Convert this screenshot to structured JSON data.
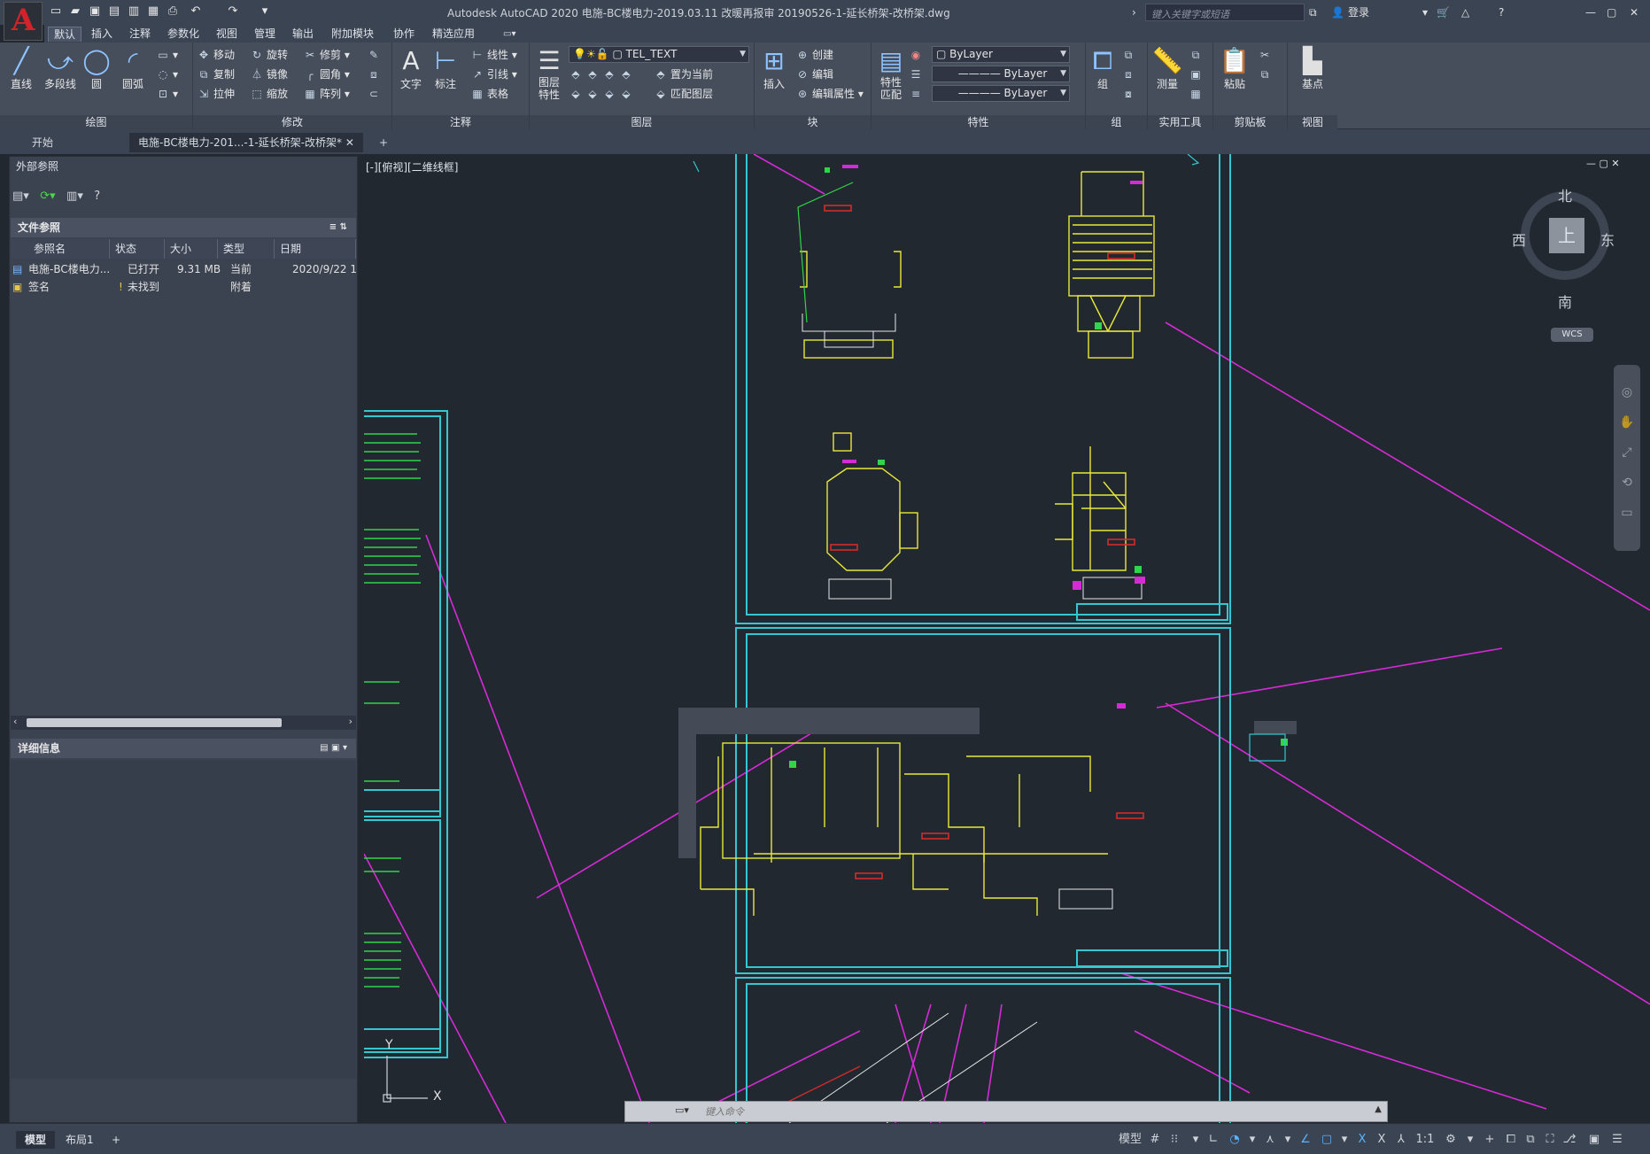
{
  "titlebar": {
    "title": "Autodesk AutoCAD 2020    电施-BC楼电力-2019.03.11 改暖再报审 20190526-1-延长桥架-改桥架.dwg",
    "search_placeholder": "键入关键字或短语",
    "login": "登录"
  },
  "menu": [
    "默认",
    "插入",
    "注释",
    "参数化",
    "视图",
    "管理",
    "输出",
    "附加模块",
    "协作",
    "精选应用"
  ],
  "ribbon": {
    "draw": {
      "title": "绘图",
      "line": "直线",
      "polyline": "多段线",
      "circle": "圆",
      "arc": "圆弧"
    },
    "modify": {
      "title": "修改",
      "move": "移动",
      "rotate": "旋转",
      "trim": "修剪",
      "copy": "复制",
      "mirror": "镜像",
      "fillet": "圆角",
      "stretch": "拉伸",
      "scale": "缩放",
      "array": "阵列"
    },
    "annotation": {
      "title": "注释",
      "text": "文字",
      "dim": "标注",
      "linear": "线性",
      "leader": "引线",
      "table": "表格"
    },
    "layers": {
      "title": "图层",
      "props": "图层\n特性",
      "layer_name": "TEL_TEXT",
      "set_current": "置为当前",
      "match": "匹配图层"
    },
    "block": {
      "title": "块",
      "insert": "插入",
      "create": "创建",
      "edit": "编辑",
      "edit_attr": "编辑属性"
    },
    "properties": {
      "title": "特性",
      "match": "特性\n匹配",
      "color": "ByLayer",
      "linetype": "ByLayer",
      "lineweight": "ByLayer"
    },
    "groups": {
      "title": "组",
      "group": "组"
    },
    "utilities": {
      "title": "实用工具",
      "measure": "测量"
    },
    "clipboard": {
      "title": "剪贴板",
      "paste": "粘贴"
    },
    "view": {
      "title": "视图",
      "base": "基点"
    }
  },
  "filetabs": {
    "start": "开始",
    "doc": "电施-BC楼电力-201...-1-延长桥架-改桥架*",
    "plus": "+"
  },
  "xref": {
    "title": "外部参照",
    "section": "文件参照",
    "columns": [
      "参照名",
      "状态",
      "大小",
      "类型",
      "日期"
    ],
    "rows": [
      {
        "name": "电施-BC楼电力...",
        "status": "已打开",
        "size": "9.31 MB",
        "type": "当前",
        "date": "2020/9/22 1"
      },
      {
        "name": "签名",
        "status": "未找到",
        "size": "",
        "type": "附着",
        "date": ""
      }
    ],
    "details": "详细信息"
  },
  "viewport": {
    "label": "[-][俯视][二维线框]",
    "north": "北",
    "south": "南",
    "east": "东",
    "west": "西",
    "top": "上",
    "wcs": "WCS",
    "ucs_x": "X",
    "ucs_y": "Y"
  },
  "command": {
    "placeholder": "键入命令"
  },
  "status": {
    "model": "模型",
    "layout1": "布局1",
    "plus": "+",
    "model_btn": "模型",
    "scale": "1:1"
  },
  "colors": {
    "frame": "#36c6cf",
    "magenta": "#d62ad6",
    "yellow": "#e8e83a",
    "green": "#2fd64a",
    "red": "#d42a2a",
    "white": "#e8e8e8"
  }
}
